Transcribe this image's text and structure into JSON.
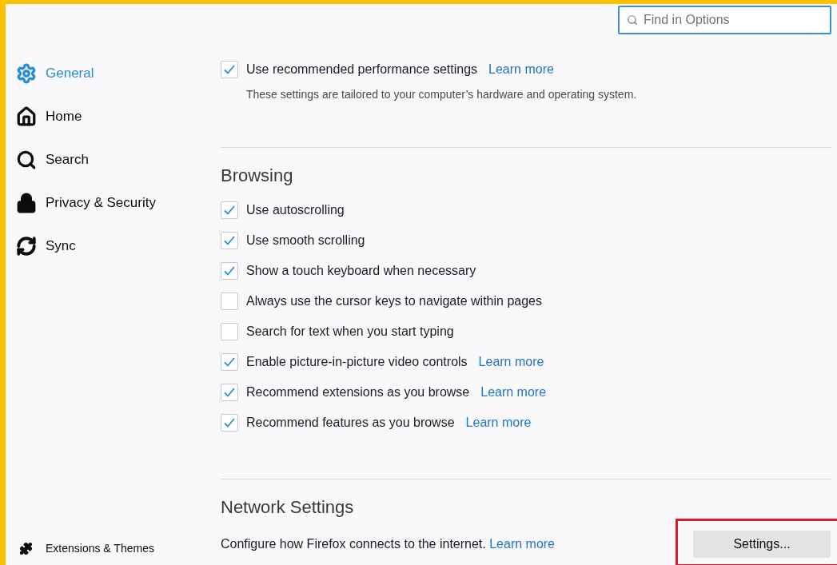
{
  "search": {
    "placeholder": "Find in Options"
  },
  "sidebar": {
    "items": [
      {
        "label": "General",
        "kind": "gear",
        "selected": true
      },
      {
        "label": "Home",
        "kind": "home",
        "selected": false
      },
      {
        "label": "Search",
        "kind": "search",
        "selected": false
      },
      {
        "label": "Privacy & Security",
        "kind": "lock",
        "selected": false
      },
      {
        "label": "Sync",
        "kind": "sync",
        "selected": false
      }
    ],
    "footer": {
      "label": "Extensions & Themes"
    }
  },
  "performance": {
    "option": {
      "label": "Use recommended performance settings",
      "checked": true,
      "link": "Learn more"
    },
    "description": "These settings are tailored to your computer’s hardware and operating system."
  },
  "browsing": {
    "heading": "Browsing",
    "options": [
      {
        "label": "Use autoscrolling",
        "checked": true
      },
      {
        "label": "Use smooth scrolling",
        "checked": true
      },
      {
        "label": "Show a touch keyboard when necessary",
        "checked": true
      },
      {
        "label": "Always use the cursor keys to navigate within pages",
        "checked": false
      },
      {
        "label": "Search for text when you start typing",
        "checked": false
      },
      {
        "label": "Enable picture-in-picture video controls",
        "checked": true,
        "link": "Learn more"
      },
      {
        "label": "Recommend extensions as you browse",
        "checked": true,
        "link": "Learn more"
      },
      {
        "label": "Recommend features as you browse",
        "checked": true,
        "link": "Learn more"
      }
    ]
  },
  "network": {
    "heading": "Network Settings",
    "description": "Configure how Firefox connects to the internet.",
    "link": "Learn more",
    "button": "Settings..."
  }
}
